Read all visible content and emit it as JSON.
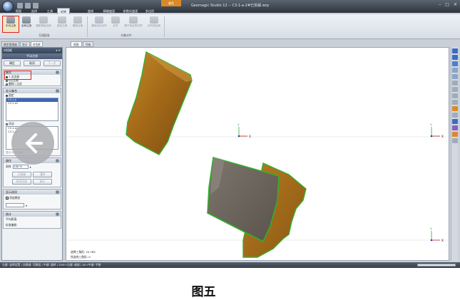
{
  "window": {
    "title": "Geomagic Studio 12 -- C3-1-a-2#已拆解.wrp",
    "context_tab": "着色"
  },
  "ribbon": {
    "tabs": [
      "视图",
      "选择",
      "工具",
      "对齐",
      "曲线",
      "精确曲面",
      "参数化曲面",
      "多边形"
    ],
    "active_tab": "对齐",
    "groups": [
      {
        "label": "扫描配准",
        "buttons": [
          "手动注册",
          "全局注册",
          "重新等级注册",
          "固定注册",
          "撤销注册"
        ]
      },
      {
        "label": "对象对齐",
        "buttons": [
          "最佳拟合对齐",
          "对齐",
          "基于特征的对齐",
          "对齐到全局"
        ]
      }
    ],
    "selected_button": "手动注册"
  },
  "left_panel": {
    "tabs": [
      "模型管理器",
      "显示",
      "对话框"
    ],
    "active_tab": "对话框",
    "header": "对话框",
    "title": "手动注册",
    "buttons": {
      "ok": "确定",
      "cancel": "取消",
      "next": "下一步"
    },
    "mode": {
      "heading": "模式",
      "options": [
        "1 点注册",
        "n点注册",
        "删除二元形"
      ],
      "selected": "1 点注册"
    },
    "define_set": {
      "heading": "定义集合",
      "fixed_label": "固定",
      "fixed_items": [
        "C3-1-a",
        "C3-1-a2"
      ],
      "floating_label": "浮动",
      "floating_items": [
        "C3-1-a2",
        "C3-1-a3"
      ],
      "footer": "显示 Grid 隐藏"
    },
    "operation": {
      "heading": "操作",
      "sample_label": "采样",
      "sample_value": "100 %",
      "buttons": [
        "注册器",
        "清除",
        "取消注册",
        "统计"
      ]
    },
    "display": {
      "heading": "显示选项",
      "checkbox": "添加预览",
      "checked": true
    },
    "stats": {
      "heading": "统计",
      "avg_distance": "平均距离:",
      "std_dev": "标准偏差:"
    }
  },
  "viewport": {
    "tabs": [
      "视图",
      "开始"
    ],
    "active_tab": "视图",
    "info": {
      "vertex_count": "选择三角形: 25,785",
      "selected": "所选的三角形: 0"
    },
    "axes": [
      {
        "y": "Y",
        "x": "X"
      },
      {
        "y": "Y",
        "x": "X"
      },
      {
        "y": "Y",
        "x": "X"
      }
    ]
  },
  "status_bar": {
    "text": "左键: 选择设置 | 交换键: 切换组 | 中键: 旋转 | Shift+右键: 缩放 | Alt+中键: 平移"
  },
  "caption": "图五",
  "colors": {
    "scan_fill": "#b5791c",
    "scan_dark": "#6e4a14",
    "scan_gray": "#6b6660",
    "boundary": "#22aa22",
    "selection_red": "#e0201c",
    "list_selection": "#3c67b8"
  }
}
